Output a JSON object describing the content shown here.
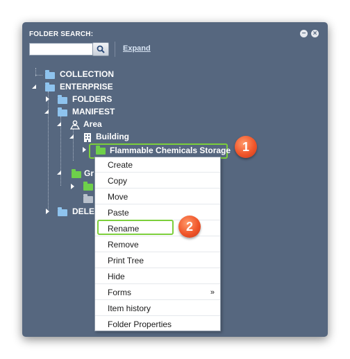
{
  "panel": {
    "title": "FOLDER SEARCH:",
    "expand_label": "Expand",
    "search": {
      "value": "",
      "placeholder": ""
    }
  },
  "tree": {
    "collection": "COLLECTION",
    "enterprise": "ENTERPRISE",
    "folders": "FOLDERS",
    "manifest": "MANIFEST",
    "area": "Area",
    "building": "Building",
    "selected": "Flammable Chemicals Storage",
    "group_partial": "Gr",
    "deleted_partial": "DELE"
  },
  "context_menu": {
    "items": [
      {
        "label": "Create"
      },
      {
        "label": "Copy"
      },
      {
        "label": "Move"
      },
      {
        "label": "Paste"
      },
      {
        "label": "Rename"
      },
      {
        "label": "Remove"
      },
      {
        "label": "Print Tree"
      },
      {
        "label": "Hide"
      },
      {
        "label": "Forms",
        "submenu_arrow": "»"
      },
      {
        "label": "Item history"
      },
      {
        "label": "Folder Properties"
      }
    ]
  },
  "annotations": {
    "step1": "1",
    "step2": "2"
  },
  "colors": {
    "panel_bg": "#56677f",
    "highlight": "#7ccf3b",
    "badge": "#f0562a",
    "folder_blue": "#8ec3ee",
    "folder_green": "#6ed04a"
  }
}
